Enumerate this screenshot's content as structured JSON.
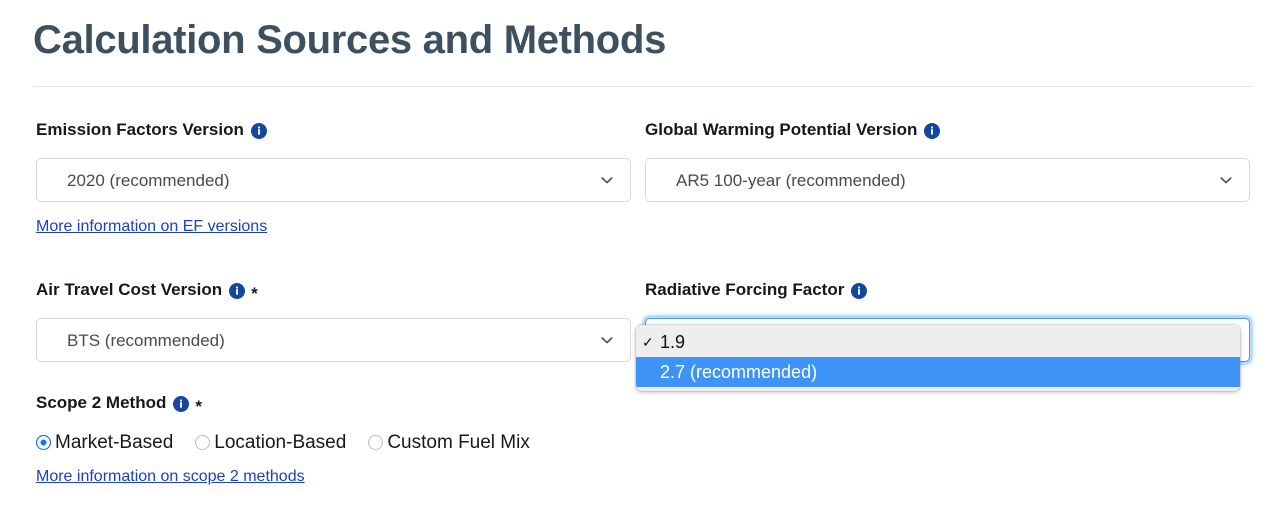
{
  "page": {
    "title": "Calculation Sources and Methods"
  },
  "fields": {
    "emission_factors": {
      "label": "Emission Factors Version",
      "info_icon": "info-icon",
      "required_marker": "",
      "value": "2020 (recommended)",
      "chevron_icon": "chevron-down-icon",
      "link": "More information on EF versions"
    },
    "gwp": {
      "label": "Global Warming Potential Version",
      "info_icon": "info-icon",
      "required_marker": "",
      "value": "AR5 100-year (recommended)",
      "chevron_icon": "chevron-down-icon"
    },
    "air_travel": {
      "label": "Air Travel Cost Version",
      "info_icon": "info-icon",
      "required_marker": "*",
      "value": "BTS (recommended)",
      "chevron_icon": "chevron-down-icon"
    },
    "radiative_forcing": {
      "label": "Radiative Forcing Factor",
      "info_icon": "info-icon",
      "required_marker": "",
      "value": "1.9",
      "chevron_icon": "chevron-down-icon",
      "open": true,
      "options": [
        {
          "label": "1.9",
          "tick": "✓",
          "highlighted": false
        },
        {
          "label": "2.7 (recommended)",
          "tick": "",
          "highlighted": true
        }
      ]
    },
    "scope2": {
      "label": "Scope 2 Method",
      "info_icon": "info-icon",
      "required_marker": "*",
      "options": [
        {
          "label": "Market-Based",
          "checked": true
        },
        {
          "label": "Location-Based",
          "checked": false
        },
        {
          "label": "Custom Fuel Mix",
          "checked": false
        }
      ],
      "link": "More information on scope 2 methods"
    }
  },
  "colors": {
    "title": "#3d505f",
    "label": "#14191f",
    "link": "#1a3fc4",
    "info_badge": "#14489c",
    "dropdown_highlight": "#3d94f6",
    "dropdown_bg": "#eeeeee",
    "focus_border": "#4a9ae0",
    "radio_selected": "#1a73e8"
  }
}
